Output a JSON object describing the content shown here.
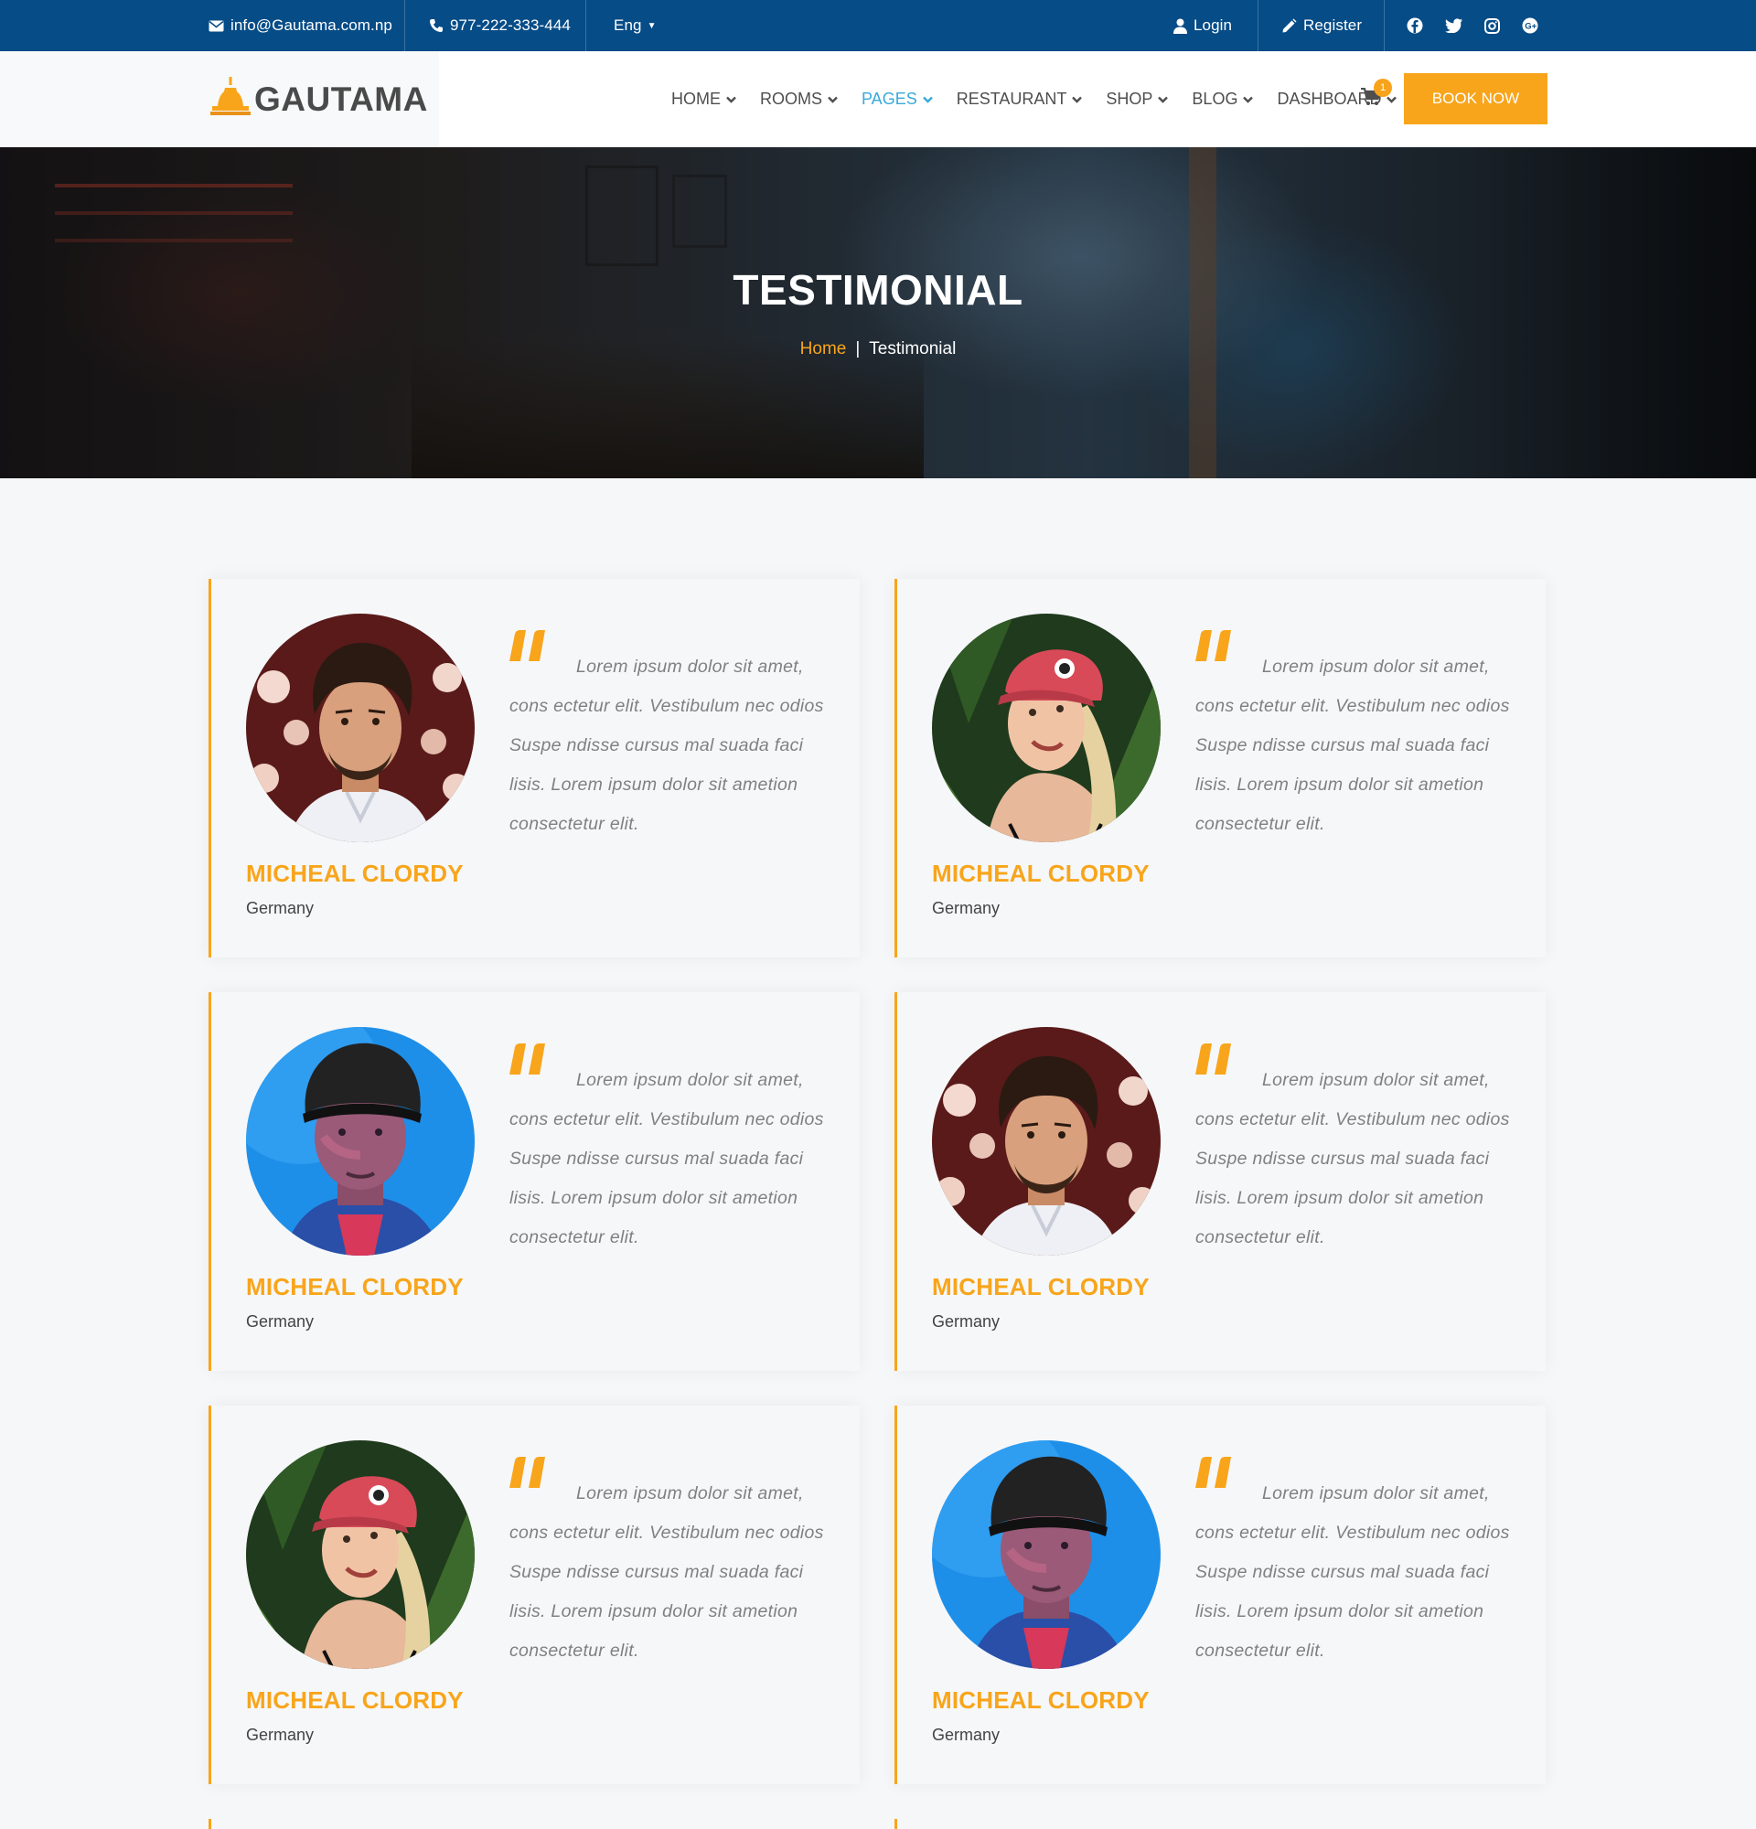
{
  "topbar": {
    "email": "info@Gautama.com.np",
    "phone": "977-222-333-444",
    "language": "Eng",
    "login": "Login",
    "register": "Register",
    "social_icons": [
      "facebook-icon",
      "twitter-icon",
      "instagram-icon",
      "google-plus-icon"
    ]
  },
  "brand": {
    "logo_text": "GAUTAMA",
    "accent": "#f8a51b",
    "topbar_bg": "#064c87"
  },
  "nav": {
    "items": [
      {
        "label": "HOME",
        "active": false
      },
      {
        "label": "ROOMS",
        "active": false
      },
      {
        "label": "PAGES",
        "active": true
      },
      {
        "label": "RESTAURANT",
        "active": false
      },
      {
        "label": "SHOP",
        "active": false
      },
      {
        "label": "BLOG",
        "active": false
      },
      {
        "label": "DASHBOARD",
        "active": false
      }
    ],
    "cart_count": "1",
    "book_now": "BOOK NOW"
  },
  "hero": {
    "title": "TESTIMONIAL",
    "breadcrumb_home": "Home",
    "breadcrumb_separator": "|",
    "breadcrumb_current": "Testimonial"
  },
  "testimonials": [
    {
      "name": "MICHEAL CLORDY",
      "location": "Germany",
      "text": "Lorem ipsum dolor sit amet, cons ectetur elit. Vestibulum nec odios Suspe ndisse cursus mal suada faci lisis. Lorem ipsum dolor sit ametion consectetur elit.",
      "avatar": "man-curly-hair"
    },
    {
      "name": "MICHEAL CLORDY",
      "location": "Germany",
      "text": "Lorem ipsum dolor sit amet, cons ectetur elit. Vestibulum nec odios Suspe ndisse cursus mal suada faci lisis. Lorem ipsum dolor sit ametion consectetur elit.",
      "avatar": "woman-red-cap"
    },
    {
      "name": "MICHEAL CLORDY",
      "location": "Germany",
      "text": "Lorem ipsum dolor sit amet, cons ectetur elit. Vestibulum nec odios Suspe ndisse cursus mal suada faci lisis. Lorem ipsum dolor sit ametion consectetur elit.",
      "avatar": "man-black-cap-blue"
    },
    {
      "name": "MICHEAL CLORDY",
      "location": "Germany",
      "text": "Lorem ipsum dolor sit amet, cons ectetur elit. Vestibulum nec odios Suspe ndisse cursus mal suada faci lisis. Lorem ipsum dolor sit ametion consectetur elit.",
      "avatar": "man-curly-hair"
    },
    {
      "name": "MICHEAL CLORDY",
      "location": "Germany",
      "text": "Lorem ipsum dolor sit amet, cons ectetur elit. Vestibulum nec odios Suspe ndisse cursus mal suada faci lisis. Lorem ipsum dolor sit ametion consectetur elit.",
      "avatar": "woman-red-cap"
    },
    {
      "name": "MICHEAL CLORDY",
      "location": "Germany",
      "text": "Lorem ipsum dolor sit amet, cons ectetur elit. Vestibulum nec odios Suspe ndisse cursus mal suada faci lisis. Lorem ipsum dolor sit ametion consectetur elit.",
      "avatar": "man-black-cap-blue"
    }
  ]
}
